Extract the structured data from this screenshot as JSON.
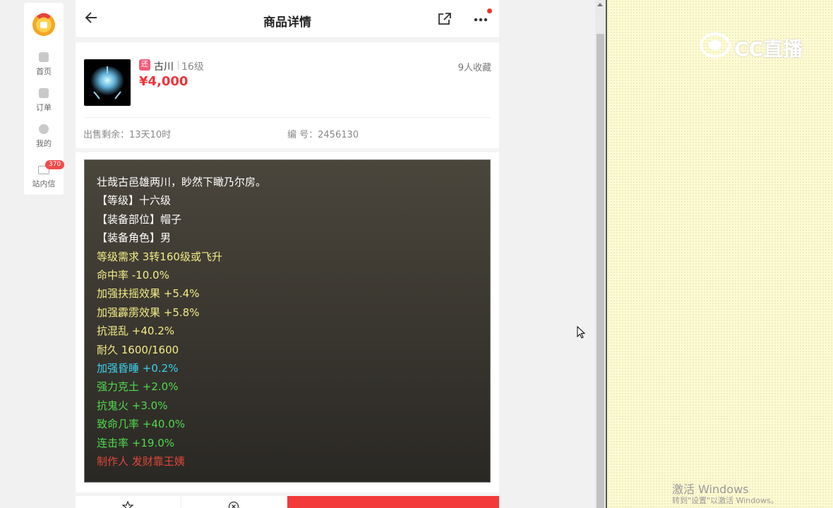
{
  "sidebar": {
    "items": [
      {
        "label": "首页",
        "icon": "home-icon"
      },
      {
        "label": "订单",
        "icon": "order-icon"
      },
      {
        "label": "我的",
        "icon": "user-icon"
      },
      {
        "label": "站内信",
        "icon": "mail-icon",
        "badge": "370"
      }
    ]
  },
  "header": {
    "title": "商品详情"
  },
  "product": {
    "server_tag": "还",
    "server": "古川",
    "level": "16级",
    "price": "¥4,000",
    "favorites": "9人收藏",
    "remain": "出售剩余：13天10时",
    "code": "编 号：2456130"
  },
  "description": [
    {
      "text": "壮哉古邑雄两川，眇然下瞰乃尔房。",
      "color": "#ffffff"
    },
    {
      "text": "【等级】十六级",
      "color": "#ffffff"
    },
    {
      "text": "【装备部位】帽子",
      "color": "#ffffff"
    },
    {
      "text": "【装备角色】男",
      "color": "#ffffff"
    },
    {
      "text": "等级需求 3转160级或飞升",
      "color": "#f4ec86"
    },
    {
      "text": "命中率 -10.0%",
      "color": "#f4ec86"
    },
    {
      "text": "加强扶摇效果 +5.4%",
      "color": "#f4ec86"
    },
    {
      "text": "加强霹雳效果 +5.8%",
      "color": "#f4ec86"
    },
    {
      "text": "抗混乱 +40.2%",
      "color": "#f4ec86"
    },
    {
      "text": "耐久 1600/1600",
      "color": "#f4ec86"
    },
    {
      "text": "加强昏睡 +0.2%",
      "color": "#39d2f0"
    },
    {
      "text": "强力克土 +2.0%",
      "color": "#4fdb4f"
    },
    {
      "text": "抗鬼火 +3.0%",
      "color": "#4fdb4f"
    },
    {
      "text": "致命几率 +40.0%",
      "color": "#4fdb4f"
    },
    {
      "text": "连击率 +19.0%",
      "color": "#4fdb4f"
    },
    {
      "text": "制作人 发财靠王姨",
      "color": "#e0463a"
    }
  ],
  "overlay": {
    "cc_logo": "CC直播",
    "activate_title": "激活 Windows",
    "activate_hint": "转到\"设置\"以激活 Windows。"
  },
  "colors": {
    "accent": "#f23a3a",
    "price": "#f0343a"
  }
}
